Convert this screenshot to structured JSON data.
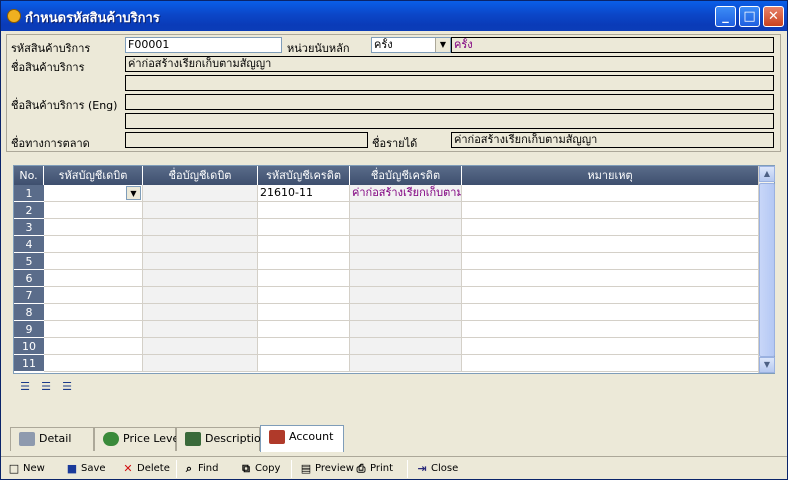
{
  "window": {
    "title": "กำหนดรหัสสินค้าบริการ"
  },
  "form": {
    "code_label": "รหัสสินค้าบริการ",
    "code_value": "F00001",
    "unit_label": "หน่วยนับหลัก",
    "unit_value": "ครั้ง",
    "unit_display": "ครั้ง",
    "name_label": "ชื่อสินค้าบริการ",
    "name_value": "ค่าก่อสร้างเรียกเก็บตามสัญญา",
    "name_value2": "",
    "name_eng_label": "ชื่อสินค้าบริการ (Eng)",
    "name_eng_value": "",
    "name_eng_value2": "",
    "market_label": "ชื่อทางการตลาด",
    "market_value": "",
    "income_label": "ชื่อรายได้",
    "income_value": "ค่าก่อสร้างเรียกเก็บตามสัญญา"
  },
  "grid": {
    "columns": [
      "No.",
      "รหัสบัญชีเดบิต",
      "ชื่อบัญชีเดบิต",
      "รหัสบัญชีเครดิต",
      "ชื่อบัญชีเครดิต",
      "หมายเหตุ"
    ],
    "rows": [
      {
        "no": "1",
        "debit_code": "",
        "debit_name": "",
        "credit_code": "21610-11",
        "credit_name": "ค่าก่อสร้างเรียกเก็บตามสัญญา",
        "note": ""
      },
      {
        "no": "2",
        "debit_code": "",
        "debit_name": "",
        "credit_code": "",
        "credit_name": "",
        "note": ""
      },
      {
        "no": "3",
        "debit_code": "",
        "debit_name": "",
        "credit_code": "",
        "credit_name": "",
        "note": ""
      },
      {
        "no": "4",
        "debit_code": "",
        "debit_name": "",
        "credit_code": "",
        "credit_name": "",
        "note": ""
      },
      {
        "no": "5",
        "debit_code": "",
        "debit_name": "",
        "credit_code": "",
        "credit_name": "",
        "note": ""
      },
      {
        "no": "6",
        "debit_code": "",
        "debit_name": "",
        "credit_code": "",
        "credit_name": "",
        "note": ""
      },
      {
        "no": "7",
        "debit_code": "",
        "debit_name": "",
        "credit_code": "",
        "credit_name": "",
        "note": ""
      },
      {
        "no": "8",
        "debit_code": "",
        "debit_name": "",
        "credit_code": "",
        "credit_name": "",
        "note": ""
      },
      {
        "no": "9",
        "debit_code": "",
        "debit_name": "",
        "credit_code": "",
        "credit_name": "",
        "note": ""
      },
      {
        "no": "10",
        "debit_code": "",
        "debit_name": "",
        "credit_code": "",
        "credit_name": "",
        "note": ""
      },
      {
        "no": "11",
        "debit_code": "",
        "debit_name": "",
        "credit_code": "",
        "credit_name": "",
        "note": ""
      }
    ]
  },
  "tabs": [
    {
      "label": "Detail",
      "icon": "detail-icon"
    },
    {
      "label": "Price Level",
      "icon": "money-bag-icon"
    },
    {
      "label": "Description",
      "icon": "notebook-icon"
    },
    {
      "label": "Account",
      "icon": "ledger-icon"
    }
  ],
  "toolbar": {
    "new": "New",
    "save": "Save",
    "delete": "Delete",
    "find": "Find",
    "copy": "Copy",
    "preview": "Preview",
    "print": "Print",
    "close": "Close"
  },
  "colors": {
    "title_bar": "#0A46C8",
    "grid_header": "#4E5F7E",
    "purple_text": "#800080"
  }
}
